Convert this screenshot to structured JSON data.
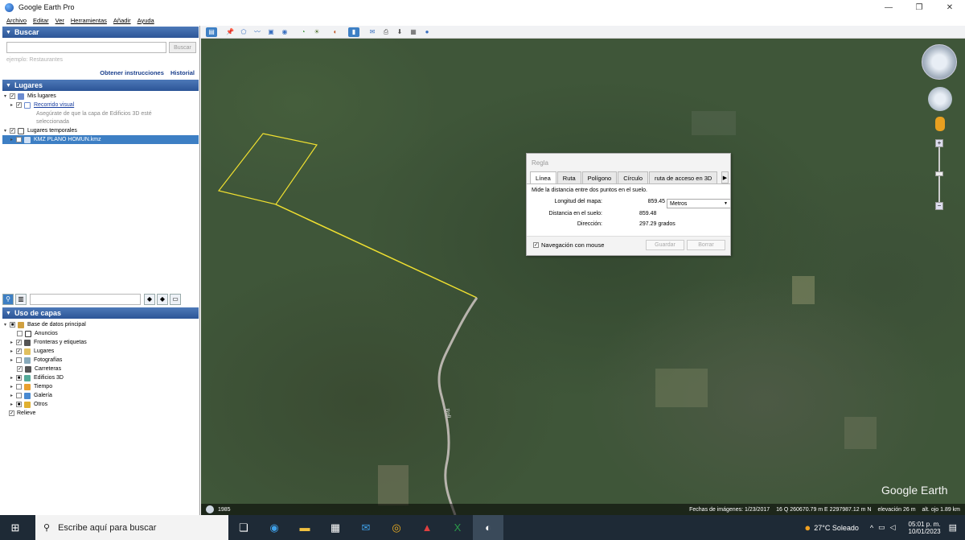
{
  "window": {
    "title": "Google Earth Pro",
    "buttons": [
      "—",
      "❐",
      "✕"
    ]
  },
  "menu": [
    "Archivo",
    "Editar",
    "Ver",
    "Herramientas",
    "Añadir",
    "Ayuda"
  ],
  "search": {
    "header": "Buscar",
    "button": "Buscar",
    "placeholder": "ejemplo: Restaurantes",
    "link_instructions": "Obtener instrucciones",
    "link_history": "Historial"
  },
  "places": {
    "header": "Lugares",
    "my_places": "Mis lugares",
    "tour": "Recorrido visual",
    "tour_note_1": "Asegúrate de que la capa de Edificios 3D esté",
    "tour_note_2": "seleccionada",
    "temp_places": "Lugares temporales",
    "kmz": "KMZ PLANO HOMUN.kmz"
  },
  "layers": {
    "header": "Uso de capas",
    "items": [
      "Base de datos principal",
      "Anuncios",
      "Fronteras y etiquetas",
      "Lugares",
      "Fotografías",
      "Carreteras",
      "Edificios 3D",
      "Tiempo",
      "Galería",
      "Otros",
      "Relieve"
    ]
  },
  "ruler": {
    "title": "Regla",
    "tabs": [
      "Línea",
      "Ruta",
      "Polígono",
      "Círculo",
      "ruta de acceso en 3D"
    ],
    "description": "Mide la distancia entre dos puntos en el suelo.",
    "map_length_label": "Longitud del mapa:",
    "map_length_value": "859.45",
    "unit": "Metros",
    "ground_label": "Distancia en el suelo:",
    "ground_value": "859.48",
    "heading_label": "Dirección:",
    "heading_value": "297.29 grados",
    "mouse_nav": "Navegación con mouse",
    "save": "Guardar",
    "clear": "Borrar"
  },
  "map": {
    "road_label": "Bnll",
    "watermark": "Google Earth",
    "year": "1985"
  },
  "status": {
    "imagery_date": "Fechas de imágenes: 1/23/2017",
    "coords": "16 Q 260670.79 m E 2297987.12 m N",
    "elevation": "elevación    26 m",
    "eye_alt": "alt. ojo   1.89 km"
  },
  "taskbar": {
    "search_placeholder": "Escribe aquí para buscar",
    "temperature": "27°C  Soleado",
    "time": "05:01 p. m.",
    "date": "10/01/2023"
  },
  "colors": {
    "panel_header": "#2c5597",
    "selection": "#3d7fc4",
    "path": "#f0e030"
  }
}
